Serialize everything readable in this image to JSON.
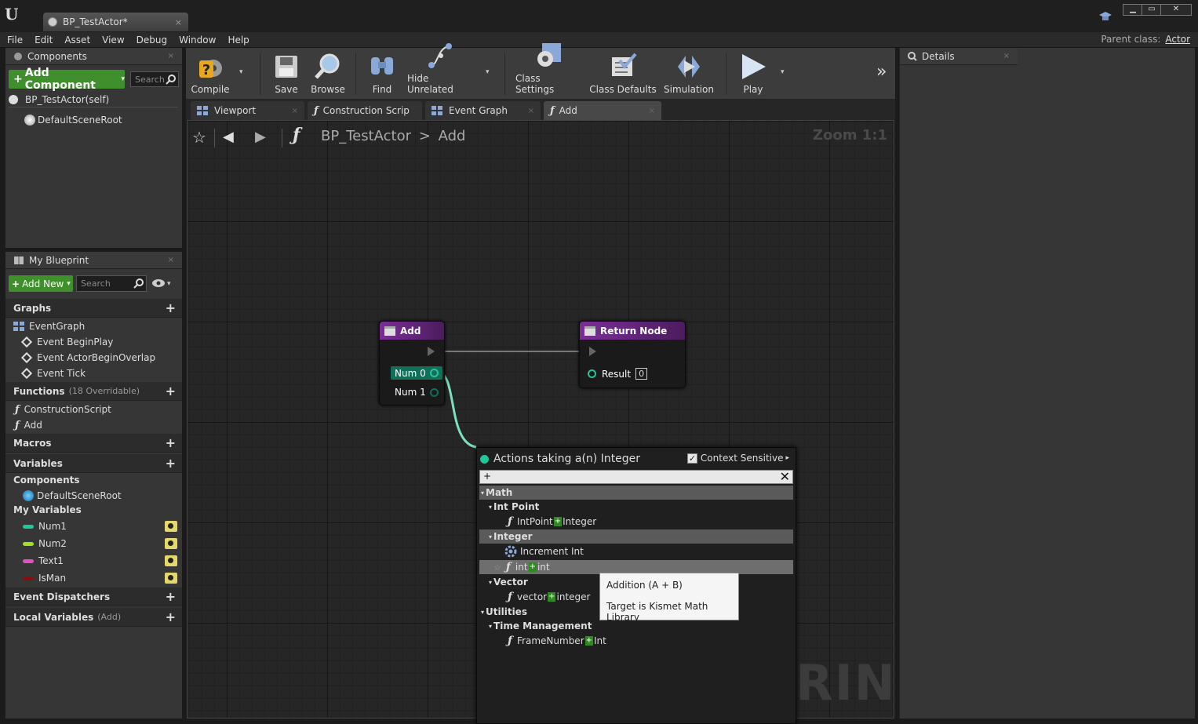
{
  "window": {
    "doc_tab": "BP_TestActor*",
    "min": "▁",
    "max": "▭",
    "close": "✕",
    "close_tab": "×",
    "logo": "U"
  },
  "menu": [
    "File",
    "Edit",
    "Asset",
    "View",
    "Debug",
    "Window",
    "Help"
  ],
  "parent_class": {
    "label": "Parent class:",
    "value": "Actor"
  },
  "components_panel": {
    "tab": "Components",
    "add_button": "Add Component",
    "search_placeholder": "Search",
    "self_row": "BP_TestActor(self)",
    "root": "DefaultSceneRoot"
  },
  "my_blueprint": {
    "tab": "My Blueprint",
    "add_new": "Add New",
    "search_placeholder": "Search",
    "graphs": "Graphs",
    "event_graph": "EventGraph",
    "events": [
      "Event BeginPlay",
      "Event ActorBeginOverlap",
      "Event Tick"
    ],
    "functions": "Functions",
    "functions_note": "(18 Overridable)",
    "function_items": [
      "ConstructionScript",
      "Add"
    ],
    "macros": "Macros",
    "variables": "Variables",
    "components_label": "Components",
    "components_item": "DefaultSceneRoot",
    "my_variables": "My Variables",
    "vars": [
      {
        "name": "Num1",
        "color": "#1fc79a"
      },
      {
        "name": "Num2",
        "color": "#9ee21f"
      },
      {
        "name": "Text1",
        "color": "#e24fc7"
      },
      {
        "name": "IsMan",
        "color": "#8a0e0e"
      }
    ],
    "event_dispatchers": "Event Dispatchers",
    "local_variables": "Local Variables",
    "local_note": "(Add)"
  },
  "toolbar": {
    "compile": "Compile",
    "save": "Save",
    "browse": "Browse",
    "find": "Find",
    "hide_unrelated": "Hide Unrelated",
    "class_settings": "Class Settings",
    "class_defaults": "Class Defaults",
    "simulation": "Simulation",
    "play": "Play",
    "more": "»"
  },
  "graph_tabs": [
    "Viewport",
    "Construction Scrip",
    "Event Graph",
    "Add"
  ],
  "graph": {
    "crumb_root": "BP_TestActor",
    "crumb_sep": ">",
    "crumb_leaf": "Add",
    "zoom": "Zoom 1:1",
    "watermark": "RINT"
  },
  "nodes": {
    "add": {
      "title": "Add",
      "pins": [
        "Num 0",
        "Num 1"
      ]
    },
    "return": {
      "title": "Return Node",
      "pin": "Result",
      "value": "0"
    }
  },
  "action_menu": {
    "title": "Actions taking a(n) Integer",
    "context_label": "Context Sensitive",
    "search_value": "+",
    "cat_math": "Math",
    "sub_intpoint": "Int Point",
    "item_intpoint": [
      "IntPoint",
      "Integer"
    ],
    "cat_integer": "Integer",
    "item_increment": "Increment Int",
    "item_intint": [
      "int",
      "int"
    ],
    "sub_vector": "Vector",
    "item_vector": [
      "vector",
      "integer"
    ],
    "cat_utilities": "Utilities",
    "sub_time": "Time Management",
    "item_frame": [
      "FrameNumber",
      "Int"
    ]
  },
  "tooltip": {
    "line1": "Addition (A + B)",
    "line2": "Target is Kismet Math Library"
  },
  "details": {
    "tab": "Details"
  },
  "glyphs": {
    "plus": "+",
    "star": "☆",
    "fn": "ƒ",
    "check": "✓",
    "eye_caret": "▾",
    "back": "◀",
    "fwd": "▶",
    "caret": "▸",
    "close_x": "✕"
  }
}
